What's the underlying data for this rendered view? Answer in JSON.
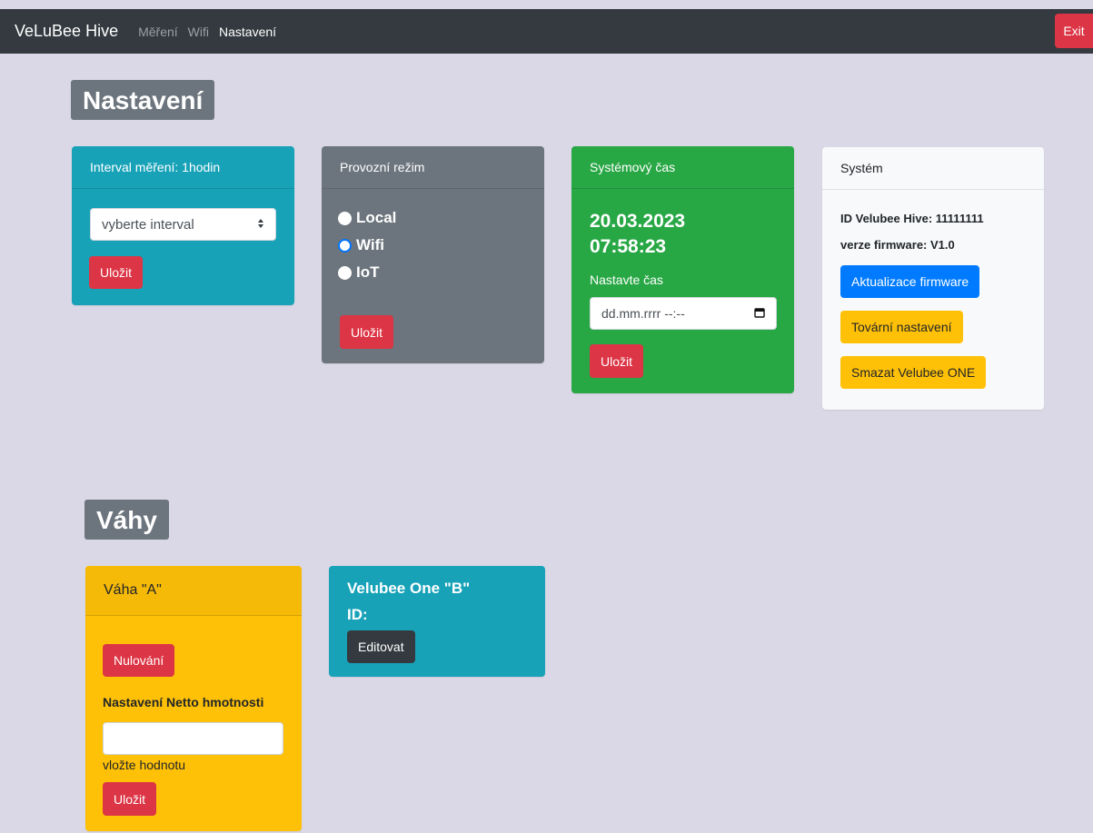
{
  "nav": {
    "brand": "VeLuBee Hive",
    "links": [
      "Měření",
      "Wifi",
      "Nastavení"
    ],
    "exit_label": "Exit"
  },
  "settings": {
    "heading": "Nastavení",
    "interval_card": {
      "title": "Interval měření: 1hodin",
      "select_value": "vyberte interval",
      "save_label": "Uložit"
    },
    "mode_card": {
      "title": "Provozní režim",
      "options": [
        "Local",
        "Wifi",
        "IoT"
      ],
      "selected": "Wifi",
      "save_label": "Uložit"
    },
    "time_card": {
      "title": "Systémový čas",
      "date": "20.03.2023",
      "time": "07:58:23",
      "set_label": "Nastavte čas",
      "input_placeholder": "dd.mm.rrrr --:--",
      "save_label": "Uložit"
    },
    "system_card": {
      "title": "Systém",
      "id_line": "ID Velubee Hive: 11111111",
      "firmware_line": "verze firmware: V1.0",
      "update_label": "Aktualizace firmware",
      "factory_label": "Tovární nastavení",
      "delete_label": "Smazat Velubee ONE"
    }
  },
  "scales": {
    "heading": "Váhy",
    "scale_a": {
      "title": "Váha \"A\"",
      "tare_label": "Nulování",
      "netto_label": "Nastavení Netto hmotnosti",
      "input_value": "",
      "hint": "vložte hodnotu",
      "save_label": "Uložit"
    },
    "scale_b": {
      "title": "Velubee One \"B\"",
      "id_label": "ID:",
      "edit_label": "Editovat"
    }
  },
  "icons": {
    "select_arrow": "updown-arrow-icon",
    "calendar": "calendar-icon"
  },
  "colors": {
    "info": "#17a2b8",
    "secondary": "#6c757d",
    "success": "#28a745",
    "warning": "#ffc107",
    "danger": "#dc3545",
    "primary": "#007bff",
    "dark": "#343a40",
    "page_bg": "#dad8e6"
  }
}
